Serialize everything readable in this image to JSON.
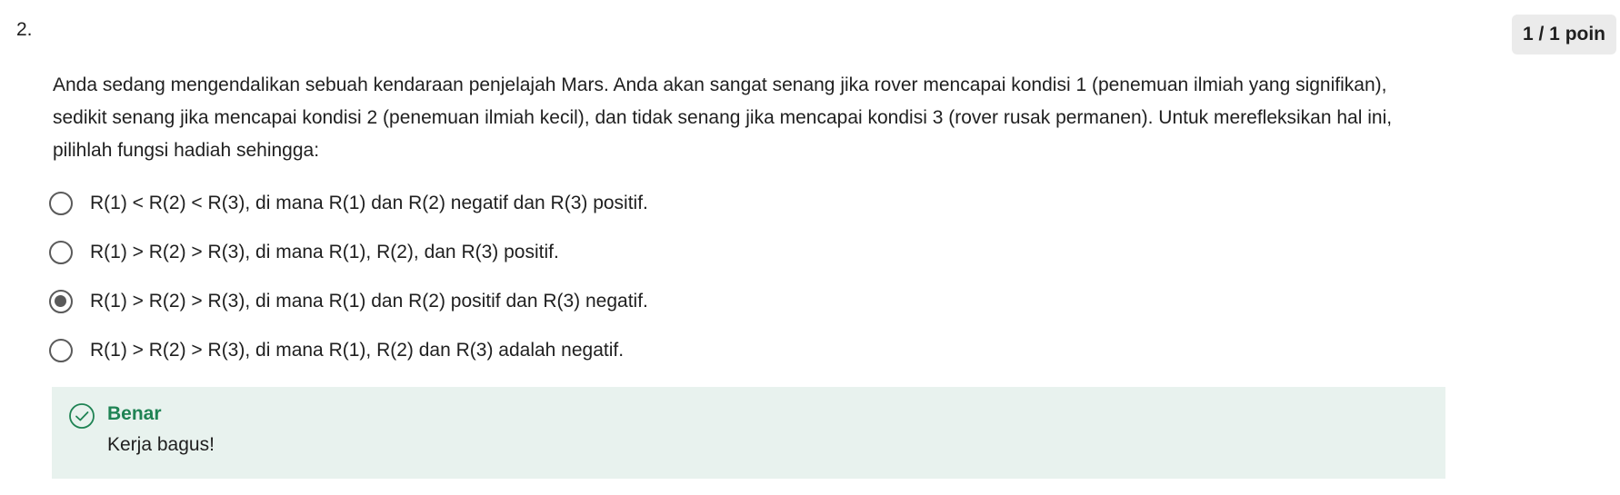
{
  "question": {
    "number": "2.",
    "points": "1 / 1 poin",
    "prompt": "Anda sedang mengendalikan sebuah kendaraan penjelajah Mars. Anda akan sangat senang jika rover mencapai kondisi 1 (penemuan ilmiah yang signifikan), sedikit senang jika mencapai kondisi 2 (penemuan ilmiah kecil), dan tidak senang jika mencapai kondisi 3 (rover rusak permanen). Untuk merefleksikan hal ini, pilihlah fungsi hadiah sehingga:"
  },
  "options": [
    {
      "label": "R(1) < R(2) < R(3), di mana R(1) dan R(2) negatif dan R(3) positif.",
      "selected": false
    },
    {
      "label": "R(1) > R(2) > R(3), di mana R(1), R(2), dan R(3) positif.",
      "selected": false
    },
    {
      "label": "R(1) > R(2) > R(3), di mana R(1) dan R(2) positif dan R(3) negatif.",
      "selected": true
    },
    {
      "label": "R(1) > R(2) > R(3), di mana R(1), R(2) dan R(3) adalah negatif.",
      "selected": false
    }
  ],
  "feedback": {
    "icon": "check-circle-icon",
    "title": "Benar",
    "message": "Kerja bagus!",
    "accent_color": "#1f8354",
    "background_color": "#e8f2ee"
  }
}
